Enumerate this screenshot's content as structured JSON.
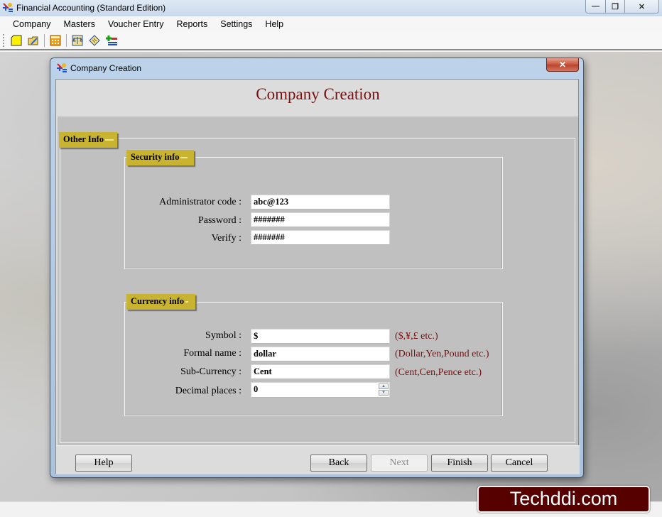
{
  "app": {
    "title": "Financial Accounting (Standard Edition)",
    "window_controls": {
      "minimize": "—",
      "restore": "❐",
      "close": "✕"
    }
  },
  "menubar": {
    "items": [
      "Company",
      "Masters",
      "Voucher Entry",
      "Reports",
      "Settings",
      "Help"
    ]
  },
  "toolbar": {
    "buttons": [
      "new-company-icon",
      "open-company-icon",
      "calculator-icon",
      "balance-scale-icon",
      "ledger-icon",
      "add-remove-icon"
    ]
  },
  "dialog": {
    "title": "Company Creation",
    "close_label": "✕",
    "heading": "Company Creation",
    "section_tab": "Other Info",
    "security": {
      "title": "Security info",
      "fields": [
        {
          "label": "Administrator code :",
          "value": "abc@123"
        },
        {
          "label": "Password :",
          "value": "#######"
        },
        {
          "label": "Verify :",
          "value": "#######"
        }
      ]
    },
    "currency": {
      "title": "Currency info",
      "fields": [
        {
          "label": "Symbol :",
          "value": "$",
          "hint": "($,¥,£ etc.)"
        },
        {
          "label": "Formal name :",
          "value": "dollar",
          "hint": "(Dollar,Yen,Pound etc.)"
        },
        {
          "label": "Sub-Currency :",
          "value": "Cent",
          "hint": "(Cent,Cen,Pence etc.)"
        },
        {
          "label": "Decimal places :",
          "value": "0"
        }
      ]
    },
    "buttons": {
      "help": "Help",
      "back": "Back",
      "next": "Next",
      "finish": "Finish",
      "cancel": "Cancel"
    }
  },
  "watermark": "Techddi.com",
  "colors": {
    "heading": "#7a1010",
    "tag": "#c8b430",
    "watermark_bg": "#570000"
  }
}
